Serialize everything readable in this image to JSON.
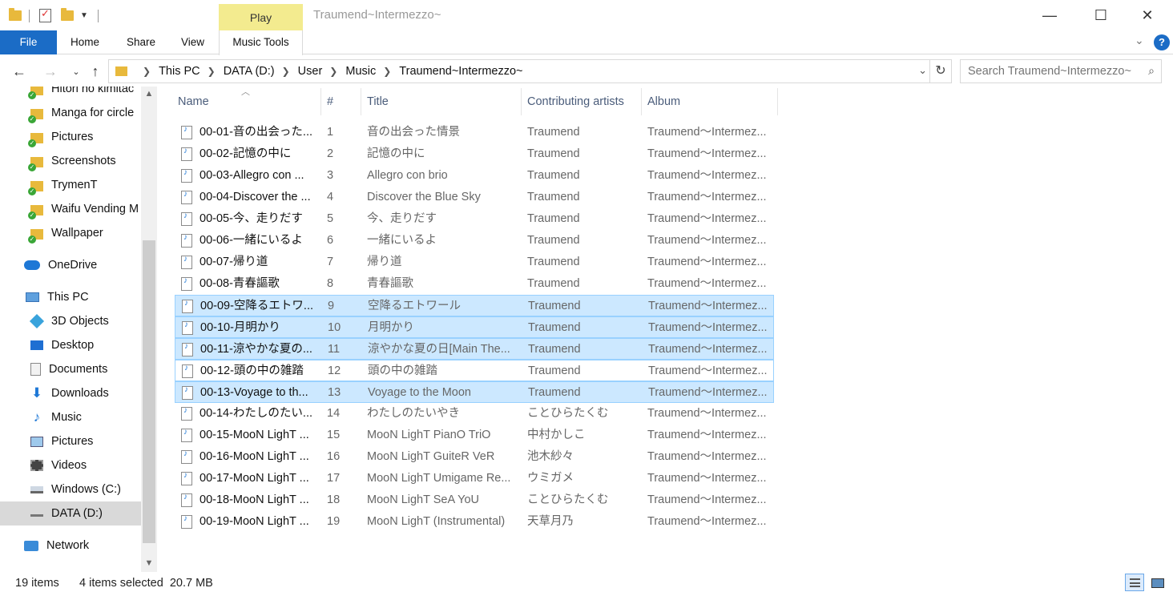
{
  "window": {
    "title": "Traumend~Intermezzo~",
    "context_tab_group": "Play",
    "buttons": {
      "minimize": "—",
      "maximize": "☐",
      "close": "✕"
    }
  },
  "ribbon": {
    "file": "File",
    "tabs": [
      "Home",
      "Share",
      "View"
    ],
    "context_tab": "Music Tools"
  },
  "address": {
    "crumbs": [
      "This PC",
      "DATA (D:)",
      "User",
      "Music",
      "Traumend~Intermezzo~"
    ],
    "search_placeholder": "Search Traumend~Intermezzo~"
  },
  "nav": {
    "items": [
      {
        "label": "Hitori no kimitac",
        "icon": "folder-sync-icon"
      },
      {
        "label": "Manga for circle",
        "icon": "folder-sync-icon"
      },
      {
        "label": "Pictures",
        "icon": "folder-sync-icon"
      },
      {
        "label": "Screenshots",
        "icon": "folder-sync-icon"
      },
      {
        "label": "TrymenT",
        "icon": "folder-sync-icon"
      },
      {
        "label": "Waifu Vending M",
        "icon": "folder-sync-icon"
      },
      {
        "label": "Wallpaper",
        "icon": "folder-sync-icon"
      },
      {
        "label": "OneDrive",
        "icon": "onedrive-icon"
      },
      {
        "label": "This PC",
        "icon": "this-pc-icon"
      },
      {
        "label": "3D Objects",
        "icon": "3d-objects-icon"
      },
      {
        "label": "Desktop",
        "icon": "desktop-icon"
      },
      {
        "label": "Documents",
        "icon": "documents-icon"
      },
      {
        "label": "Downloads",
        "icon": "downloads-icon"
      },
      {
        "label": "Music",
        "icon": "music-icon"
      },
      {
        "label": "Pictures",
        "icon": "pictures-icon"
      },
      {
        "label": "Videos",
        "icon": "videos-icon"
      },
      {
        "label": "Windows (C:)",
        "icon": "drive-c-icon"
      },
      {
        "label": "DATA (D:)",
        "icon": "drive-d-icon",
        "selected": true
      },
      {
        "label": "Network",
        "icon": "network-icon"
      }
    ]
  },
  "columns": {
    "name": "Name",
    "num": "#",
    "title": "Title",
    "artist": "Contributing artists",
    "album": "Album"
  },
  "files": [
    {
      "name": "00-01-音の出会った...",
      "num": "1",
      "title": "音の出会った情景",
      "artist": "Traumend",
      "album": "Traumend～Intermez...",
      "state": ""
    },
    {
      "name": "00-02-記憶の中に",
      "num": "2",
      "title": "記憶の中に",
      "artist": "Traumend",
      "album": "Traumend～Intermez...",
      "state": ""
    },
    {
      "name": "00-03-Allegro con ...",
      "num": "3",
      "title": "Allegro con brio",
      "artist": "Traumend",
      "album": "Traumend～Intermez...",
      "state": ""
    },
    {
      "name": "00-04-Discover the ...",
      "num": "4",
      "title": "Discover the Blue Sky",
      "artist": "Traumend",
      "album": "Traumend～Intermez...",
      "state": ""
    },
    {
      "name": "00-05-今、走りだす",
      "num": "5",
      "title": "今、走りだす",
      "artist": "Traumend",
      "album": "Traumend～Intermez...",
      "state": ""
    },
    {
      "name": "00-06-一緒にいるよ",
      "num": "6",
      "title": "一緒にいるよ",
      "artist": "Traumend",
      "album": "Traumend～Intermez...",
      "state": ""
    },
    {
      "name": "00-07-帰り道",
      "num": "7",
      "title": "帰り道",
      "artist": "Traumend",
      "album": "Traumend～Intermez...",
      "state": ""
    },
    {
      "name": "00-08-青春謳歌",
      "num": "8",
      "title": "青春謳歌",
      "artist": "Traumend",
      "album": "Traumend～Intermez...",
      "state": ""
    },
    {
      "name": "00-09-空降るエトワ...",
      "num": "9",
      "title": "空降るエトワール",
      "artist": "Traumend",
      "album": "Traumend～Intermez...",
      "state": "selected"
    },
    {
      "name": "00-10-月明かり",
      "num": "10",
      "title": "月明かり",
      "artist": "Traumend",
      "album": "Traumend～Intermez...",
      "state": "selected"
    },
    {
      "name": "00-11-涼やかな夏の...",
      "num": "11",
      "title": "涼やかな夏の日[Main The...",
      "artist": "Traumend",
      "album": "Traumend～Intermez...",
      "state": "selected"
    },
    {
      "name": "00-12-頭の中の雑踏",
      "num": "12",
      "title": "頭の中の雑踏",
      "artist": "Traumend",
      "album": "Traumend～Intermez...",
      "state": "focus"
    },
    {
      "name": "00-13-Voyage to th...",
      "num": "13",
      "title": "Voyage to the Moon",
      "artist": "Traumend",
      "album": "Traumend～Intermez...",
      "state": "selected"
    },
    {
      "name": "00-14-わたしのたい...",
      "num": "14",
      "title": "わたしのたいやき",
      "artist": "ことひらたくむ",
      "album": "Traumend～Intermez...",
      "state": ""
    },
    {
      "name": "00-15-MooN LighT ...",
      "num": "15",
      "title": "MooN LighT PianO TriO",
      "artist": "中村かしこ",
      "album": "Traumend～Intermez...",
      "state": ""
    },
    {
      "name": "00-16-MooN LighT ...",
      "num": "16",
      "title": "MooN LighT GuiteR VeR",
      "artist": "池木紗々",
      "album": "Traumend～Intermez...",
      "state": ""
    },
    {
      "name": "00-17-MooN LighT ...",
      "num": "17",
      "title": "MooN LighT Umigame Re...",
      "artist": "ウミガメ",
      "album": "Traumend～Intermez...",
      "state": ""
    },
    {
      "name": "00-18-MooN LighT ...",
      "num": "18",
      "title": "MooN LighT SeA YoU",
      "artist": "ことひらたくむ",
      "album": "Traumend～Intermez...",
      "state": ""
    },
    {
      "name": "00-19-MooN LighT ...",
      "num": "19",
      "title": "MooN LighT (Instrumental)",
      "artist": "天草月乃",
      "album": "Traumend～Intermez...",
      "state": ""
    }
  ],
  "status": {
    "count": "19 items",
    "selection": "4 items selected  20.7 MB"
  }
}
